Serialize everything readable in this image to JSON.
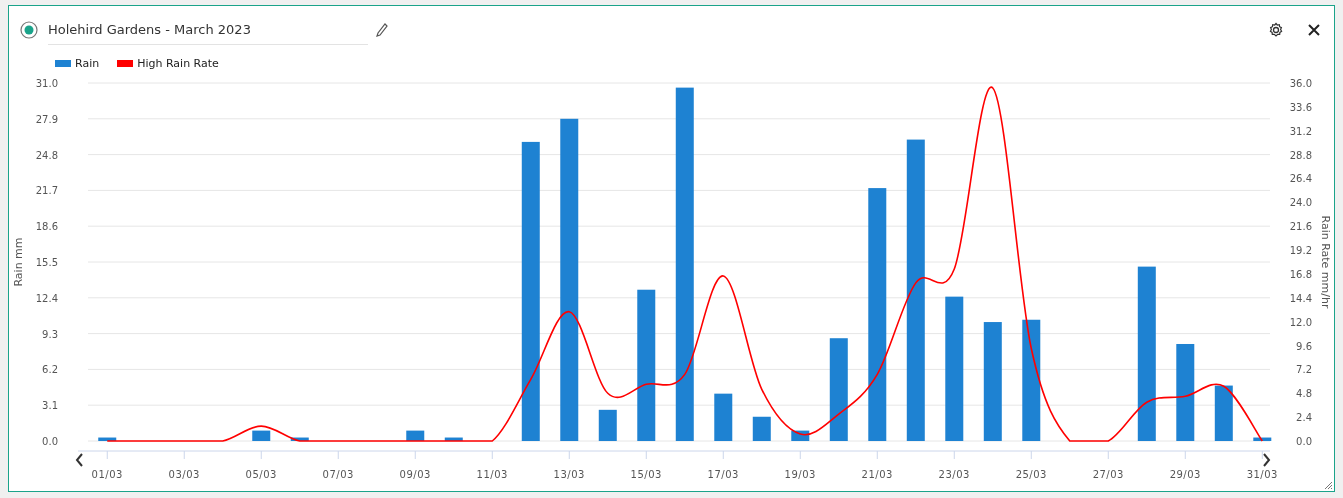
{
  "window": {
    "title": "Holehird Gardens - March 2023",
    "live": true
  },
  "chart": {
    "chart_data": {
      "type": "bar",
      "ylabel": "Rain mm",
      "y2label": "Rain Rate mm/hr",
      "categories": [
        "01/03",
        null,
        "03/03",
        null,
        "05/03",
        null,
        "07/03",
        null,
        "09/03",
        null,
        "11/03",
        null,
        "13/03",
        null,
        "15/03",
        null,
        "17/03",
        null,
        "19/03",
        null,
        "21/03",
        null,
        "23/03",
        null,
        "25/03",
        null,
        "27/03",
        null,
        "29/03",
        null,
        "31/03"
      ],
      "series": [
        {
          "name": "Rain",
          "color": "#1e82d2",
          "values": [
            0.3,
            0,
            0,
            0,
            0.9,
            0.3,
            0,
            0,
            0.9,
            0.3,
            0,
            25.9,
            27.9,
            2.7,
            13.1,
            30.6,
            4.1,
            2.1,
            0.9,
            8.9,
            21.9,
            26.1,
            12.5,
            10.3,
            10.5,
            0,
            0,
            15.1,
            8.4,
            4.8,
            0.3
          ]
        },
        {
          "name": "High Rain Rate",
          "type": "line",
          "axis": "y2",
          "color": "#ff0000",
          "values": [
            0,
            0,
            0,
            0,
            1.5,
            0,
            0,
            0,
            0,
            0,
            0,
            6.2,
            13.0,
            4.8,
            5.7,
            6.7,
            16.6,
            5.2,
            0.7,
            2.7,
            6.7,
            15.9,
            17.3,
            35.5,
            9.3,
            0,
            0,
            3.9,
            4.5,
            5.5,
            0
          ]
        }
      ],
      "grid": true,
      "ylim": [
        0,
        31
      ],
      "y2lim": [
        0,
        36
      ],
      "yticks": [
        {
          "value": 0,
          "label": "0.0"
        },
        {
          "value": 3.1,
          "label": "3.1"
        },
        {
          "value": 6.2,
          "label": "6.2"
        },
        {
          "value": 9.3,
          "label": "9.3"
        },
        {
          "value": 12.4,
          "label": "12.4"
        },
        {
          "value": 15.5,
          "label": "15.5"
        },
        {
          "value": 18.6,
          "label": "18.6"
        },
        {
          "value": 21.7,
          "label": "21.7"
        },
        {
          "value": 24.8,
          "label": "24.8"
        },
        {
          "value": 27.9,
          "label": "27.9"
        },
        {
          "value": 31,
          "label": "31.0"
        }
      ],
      "y2ticks": [
        {
          "value": 0,
          "label": "0.0"
        },
        {
          "value": 2.4,
          "label": "2.4"
        },
        {
          "value": 4.8,
          "label": "4.8"
        },
        {
          "value": 7.2,
          "label": "7.2"
        },
        {
          "value": 9.6,
          "label": "9.6"
        },
        {
          "value": 12,
          "label": "12.0"
        },
        {
          "value": 14.4,
          "label": "14.4"
        },
        {
          "value": 16.8,
          "label": "16.8"
        },
        {
          "value": 19.2,
          "label": "19.2"
        },
        {
          "value": 21.6,
          "label": "21.6"
        },
        {
          "value": 24,
          "label": "24.0"
        },
        {
          "value": 26.4,
          "label": "26.4"
        },
        {
          "value": 28.8,
          "label": "28.8"
        },
        {
          "value": 31.2,
          "label": "31.2"
        },
        {
          "value": 33.6,
          "label": "33.6"
        },
        {
          "value": 36,
          "label": "36.0"
        }
      ]
    }
  }
}
